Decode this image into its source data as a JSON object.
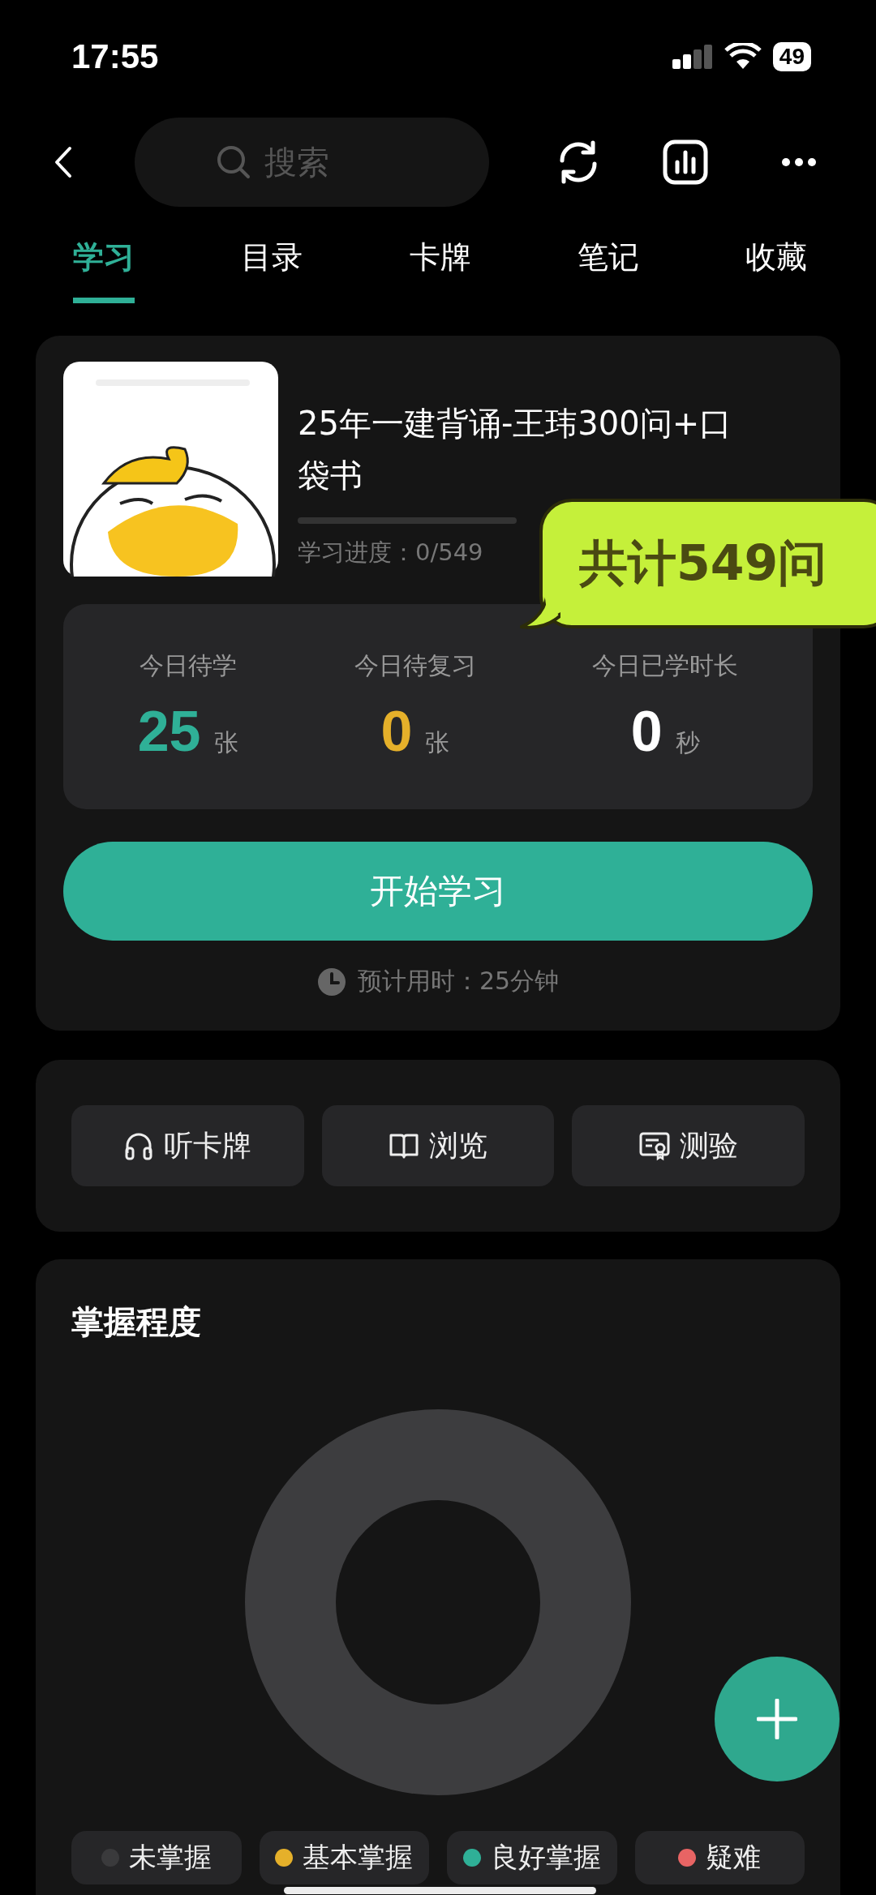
{
  "status_bar": {
    "time": "17:55",
    "battery": "49"
  },
  "search": {
    "placeholder": "搜索"
  },
  "tabs": [
    {
      "label": "学习",
      "selected": true
    },
    {
      "label": "目录",
      "selected": false
    },
    {
      "label": "卡牌",
      "selected": false
    },
    {
      "label": "笔记",
      "selected": false
    },
    {
      "label": "收藏",
      "selected": false
    }
  ],
  "deck": {
    "title": "25年一建背诵-王玮300问+口袋书",
    "level": 0,
    "progress_label": "学习进度：0/549"
  },
  "callout": "共计549问",
  "stats": [
    {
      "label": "今日待学",
      "value": "25",
      "unit": "张",
      "color": "#2fb097"
    },
    {
      "label": "今日待复习",
      "value": "0",
      "unit": "张",
      "color": "#e5b02a"
    },
    {
      "label": "今日已学时长",
      "value": "0",
      "unit": "秒",
      "color": "#ffffff"
    }
  ],
  "start_button": "开始学习",
  "estimate": "预计用时：25分钟",
  "actions": [
    {
      "kind": "listen",
      "label": "听卡牌"
    },
    {
      "kind": "browse",
      "label": "浏览"
    },
    {
      "kind": "quiz",
      "label": "测验"
    }
  ],
  "mastery": {
    "title": "掌握程度",
    "legend": [
      {
        "label": "未掌握",
        "color": "#3a3a3c"
      },
      {
        "label": "基本掌握",
        "color": "#e5b02a"
      },
      {
        "label": "良好掌握",
        "color": "#2fb097"
      },
      {
        "label": "疑难",
        "color": "#e86464"
      }
    ]
  }
}
